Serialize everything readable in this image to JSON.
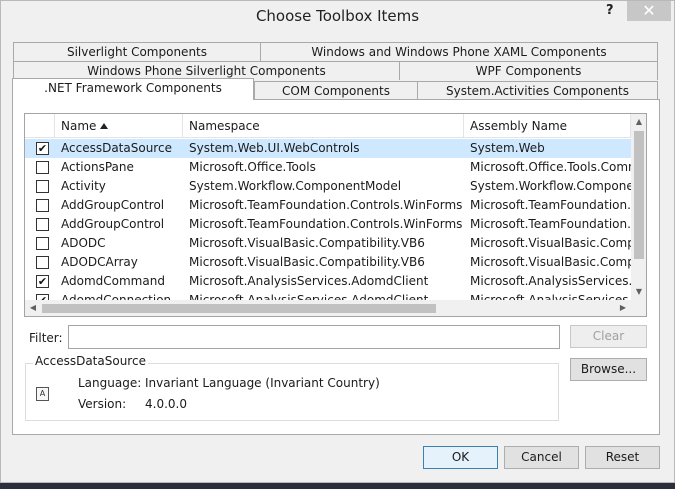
{
  "window": {
    "title": "Choose Toolbox Items",
    "help_label": "?",
    "close_label": "✕"
  },
  "tabs": {
    "row1": [
      "Silverlight Components",
      "Windows and Windows Phone XAML Components"
    ],
    "row2": [
      "Windows Phone Silverlight Components",
      "WPF Components"
    ],
    "row3": [
      ".NET Framework Components",
      "COM Components",
      "System.Activities Components"
    ],
    "active": ".NET Framework Components"
  },
  "list": {
    "columns": [
      "Name",
      "Namespace",
      "Assembly Name"
    ],
    "sort_column": "Name",
    "rows": [
      {
        "checked": true,
        "name": "AccessDataSource",
        "namespace": "System.Web.UI.WebControls",
        "assembly": "System.Web",
        "selected": true
      },
      {
        "checked": false,
        "name": "ActionsPane",
        "namespace": "Microsoft.Office.Tools",
        "assembly": "Microsoft.Office.Tools.Comn"
      },
      {
        "checked": false,
        "name": "Activity",
        "namespace": "System.Workflow.ComponentModel",
        "assembly": "System.Workflow.Compone"
      },
      {
        "checked": false,
        "name": "AddGroupControl",
        "namespace": "Microsoft.TeamFoundation.Controls.WinForms",
        "assembly": "Microsoft.TeamFoundation."
      },
      {
        "checked": false,
        "name": "AddGroupControl",
        "namespace": "Microsoft.TeamFoundation.Controls.WinForms",
        "assembly": "Microsoft.TeamFoundation."
      },
      {
        "checked": false,
        "name": "ADODC",
        "namespace": "Microsoft.VisualBasic.Compatibility.VB6",
        "assembly": "Microsoft.VisualBasic.Comp"
      },
      {
        "checked": false,
        "name": "ADODCArray",
        "namespace": "Microsoft.VisualBasic.Compatibility.VB6",
        "assembly": "Microsoft.VisualBasic.Comp"
      },
      {
        "checked": true,
        "name": "AdomdCommand",
        "namespace": "Microsoft.AnalysisServices.AdomdClient",
        "assembly": "Microsoft.AnalysisServices."
      },
      {
        "checked": true,
        "name": "AdomdConnection",
        "namespace": "Microsoft.AnalysisServices.AdomdClient",
        "assembly": "Microsoft.AnalysisServices."
      }
    ]
  },
  "filter": {
    "label": "Filter:",
    "value": "",
    "clear_label": "Clear"
  },
  "details": {
    "title": "AccessDataSource",
    "language_label": "Language:",
    "language_value": "Invariant Language (Invariant Country)",
    "version_label": "Version:",
    "version_value": "4.0.0.0",
    "icon": "component-icon",
    "icon_glyph": "A"
  },
  "buttons": {
    "browse": "Browse...",
    "ok": "OK",
    "cancel": "Cancel",
    "reset": "Reset"
  }
}
